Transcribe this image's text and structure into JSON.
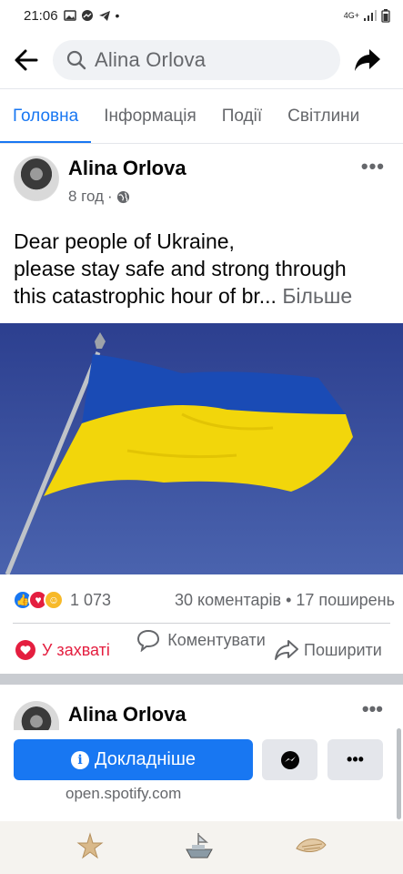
{
  "status_bar": {
    "time": "21:06",
    "network": "4G+"
  },
  "header": {
    "search_value": "Alina Orlova"
  },
  "tabs": [
    {
      "label": "Головна",
      "active": true
    },
    {
      "label": "Інформація",
      "active": false
    },
    {
      "label": "Події",
      "active": false
    },
    {
      "label": "Світлини",
      "active": false
    }
  ],
  "post": {
    "author": "Alina Orlova",
    "time": "8 год",
    "text_line1": "Dear people of Ukraine,",
    "text_line2": "please stay safe and strong through",
    "text_line3": "this catastrophic hour of br...",
    "see_more": "Більше",
    "reactions_count": "1 073",
    "comments_shares": "30 коментарів • 17 поширень",
    "like_label": "У захваті",
    "comment_label": "Коментувати",
    "share_label": "Поширити"
  },
  "post2": {
    "author": "Alina Orlova",
    "cta_label": "Докладніше",
    "link_url": "open.spotify.com"
  },
  "colors": {
    "accent": "#1877f2",
    "love": "#e41e3f",
    "flag_blue": "#1a4bb5",
    "flag_yellow": "#f2d60b"
  }
}
